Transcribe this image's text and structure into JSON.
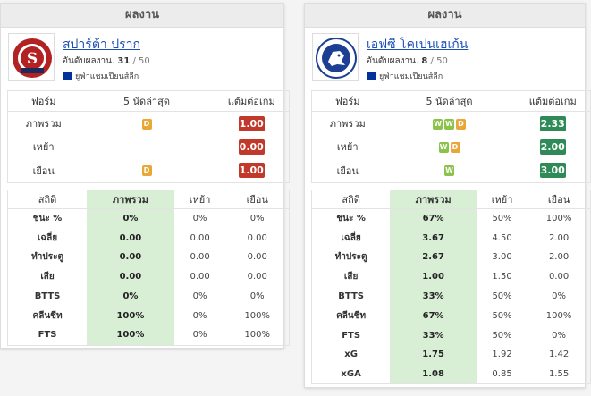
{
  "left": {
    "header": "ผลงาน",
    "team_name": "สปาร์ต้า ปราก",
    "rank_label": "อันดับผลงาน.",
    "rank": "31",
    "rank_total": "/ 50",
    "league": "ยูฟ่าแชมเปียนส์ลีก",
    "form": {
      "headers": [
        "ฟอร์ม",
        "5 นัดล่าสุด",
        "แต้มต่อเกม"
      ],
      "rows": [
        {
          "label": "ภาพรวม",
          "results": [
            "D"
          ],
          "ppg": "1.00",
          "color": "#c0392b"
        },
        {
          "label": "เหย้า",
          "results": [],
          "ppg": "0.00",
          "color": "#c0392b"
        },
        {
          "label": "เยือน",
          "results": [
            "D"
          ],
          "ppg": "1.00",
          "color": "#c0392b"
        }
      ]
    },
    "stats": {
      "headers": [
        "สถิติ",
        "ภาพรวม",
        "เหย้า",
        "เยือน"
      ],
      "rows": [
        {
          "label": "ชนะ %",
          "overall": "0%",
          "home": "0%",
          "away": "0%"
        },
        {
          "label": "เฉลี่ย",
          "overall": "0.00",
          "home": "0.00",
          "away": "0.00"
        },
        {
          "label": "ทำประตู",
          "overall": "0.00",
          "home": "0.00",
          "away": "0.00"
        },
        {
          "label": "เสีย",
          "overall": "0.00",
          "home": "0.00",
          "away": "0.00"
        },
        {
          "label": "BTTS",
          "overall": "0%",
          "home": "0%",
          "away": "0%"
        },
        {
          "label": "คลีนชีท",
          "overall": "100%",
          "home": "0%",
          "away": "100%"
        },
        {
          "label": "FTS",
          "overall": "100%",
          "home": "0%",
          "away": "100%"
        }
      ]
    }
  },
  "right": {
    "header": "ผลงาน",
    "team_name": "เอฟซี โคเปนเฮเก้น",
    "rank_label": "อันดับผลงาน.",
    "rank": "8",
    "rank_total": "/ 50",
    "league": "ยูฟ่าแชมเปียนส์ลีก",
    "form": {
      "headers": [
        "ฟอร์ม",
        "5 นัดล่าสุด",
        "แต้มต่อเกม"
      ],
      "rows": [
        {
          "label": "ภาพรวม",
          "results": [
            "W",
            "W",
            "D"
          ],
          "ppg": "2.33",
          "color": "#2e8b57"
        },
        {
          "label": "เหย้า",
          "results": [
            "W",
            "D"
          ],
          "ppg": "2.00",
          "color": "#2e8b57"
        },
        {
          "label": "เยือน",
          "results": [
            "W"
          ],
          "ppg": "3.00",
          "color": "#2e8b57"
        }
      ]
    },
    "stats": {
      "headers": [
        "สถิติ",
        "ภาพรวม",
        "เหย้า",
        "เยือน"
      ],
      "rows": [
        {
          "label": "ชนะ %",
          "overall": "67%",
          "home": "50%",
          "away": "100%"
        },
        {
          "label": "เฉลี่ย",
          "overall": "3.67",
          "home": "4.50",
          "away": "2.00"
        },
        {
          "label": "ทำประตู",
          "overall": "2.67",
          "home": "3.00",
          "away": "2.00"
        },
        {
          "label": "เสีย",
          "overall": "1.00",
          "home": "1.50",
          "away": "0.00"
        },
        {
          "label": "BTTS",
          "overall": "33%",
          "home": "50%",
          "away": "0%"
        },
        {
          "label": "คลีนชีท",
          "overall": "67%",
          "home": "50%",
          "away": "100%"
        },
        {
          "label": "FTS",
          "overall": "33%",
          "home": "50%",
          "away": "0%"
        },
        {
          "label": "xG",
          "overall": "1.75",
          "home": "1.92",
          "away": "1.42"
        },
        {
          "label": "xGA",
          "overall": "1.08",
          "home": "0.85",
          "away": "1.55"
        }
      ]
    }
  },
  "icons": {
    "left_logo": "sparta-praha-crest-icon",
    "right_logo": "fc-copenhagen-lion-crest-icon",
    "league_flag": "eu-flag-icon"
  },
  "logo_text": {
    "left": "SPARTA PRAHA",
    "right": "F.C. KØBENHAVN"
  }
}
